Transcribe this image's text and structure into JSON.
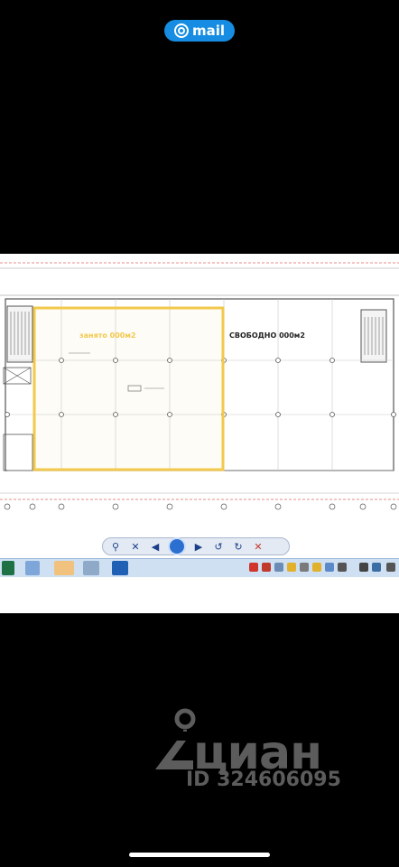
{
  "header": {
    "mail_label": "mail"
  },
  "plan": {
    "free_label": "СВОБОДНО",
    "free_area": "000м2",
    "occupied_label": "занято",
    "occupied_area": "000м2",
    "accent_color": "#f2c94c"
  },
  "viewer_toolbar": {
    "buttons": [
      "zoom",
      "close-x",
      "prev",
      "fit",
      "next",
      "rotate-left",
      "rotate-right",
      "delete"
    ]
  },
  "taskbar": {
    "apps": [
      "excel",
      "clip",
      "explorer",
      "printer",
      "outlook"
    ]
  },
  "watermark": {
    "brand": "циан",
    "listing_id": "ID 324606095"
  }
}
